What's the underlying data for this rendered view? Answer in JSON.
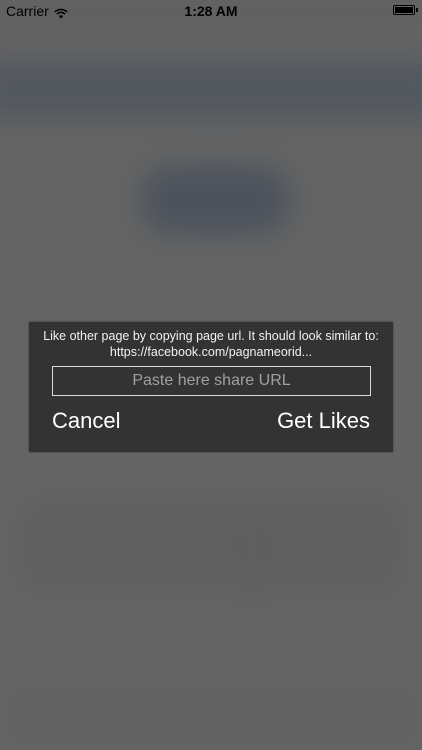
{
  "status_bar": {
    "carrier": "Carrier",
    "time": "1:28 AM",
    "icons": [
      "wifi-icon",
      "battery-icon"
    ]
  },
  "dialog": {
    "message": "Like other page by copying page url. It should look similar to: https://facebook.com/pagnameorid...",
    "input": {
      "placeholder": "Paste here share URL",
      "value": ""
    },
    "cancel_label": "Cancel",
    "confirm_label": "Get Likes"
  },
  "colors": {
    "overlay": "#464646",
    "dialog_background": "#333333",
    "dialog_text": "#ffffff",
    "input_border": "#d9d9d9",
    "placeholder": "#a0a0a0"
  }
}
